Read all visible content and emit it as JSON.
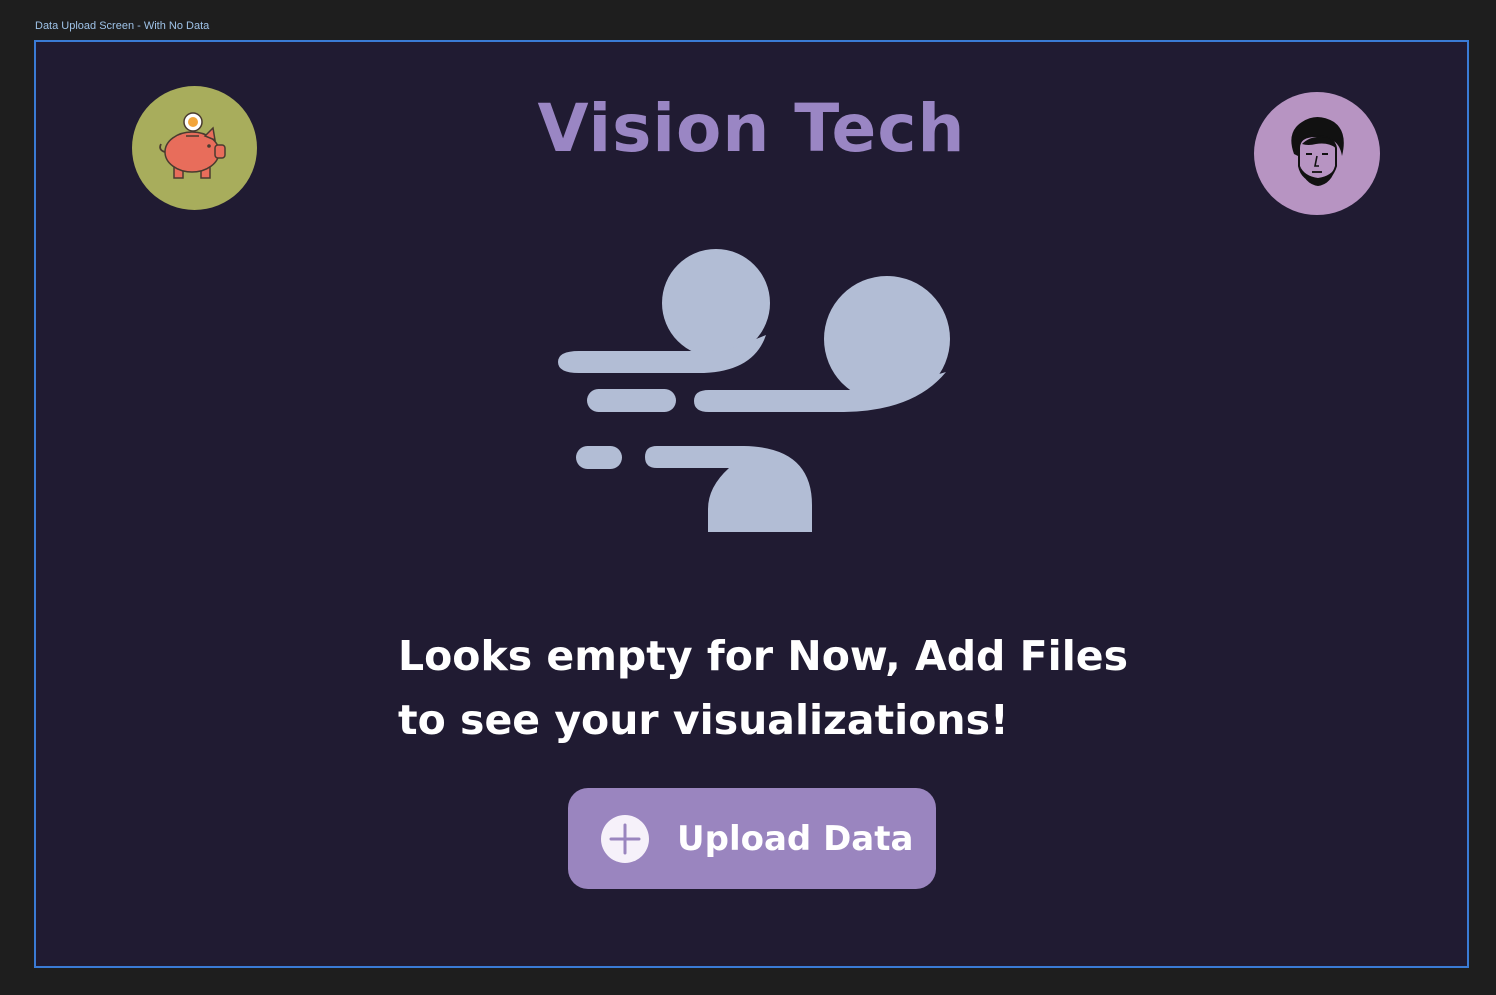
{
  "canvas": {
    "frame_label": "Data Upload Screen - With No Data"
  },
  "header": {
    "app_title": "Vision Tech",
    "logo_icon": "piggy-bank-icon",
    "avatar_icon": "user-avatar-icon"
  },
  "empty_state": {
    "illustration_icon": "wind-gust-icon",
    "message_line1": "Looks empty for Now, Add Files",
    "message_line2": "to see your visualizations!"
  },
  "actions": {
    "upload_label": "Upload Data",
    "upload_icon": "plus-circle-icon"
  },
  "colors": {
    "page_bg": "#201b32",
    "outer_bg": "#1e1e1e",
    "accent": "#9a85bf",
    "title": "#9a86c4",
    "logo_bg": "#a8ad5c",
    "avatar_bg": "#b794c2",
    "illustration": "#b2bdd5",
    "frame_border": "#3a7bd5"
  }
}
